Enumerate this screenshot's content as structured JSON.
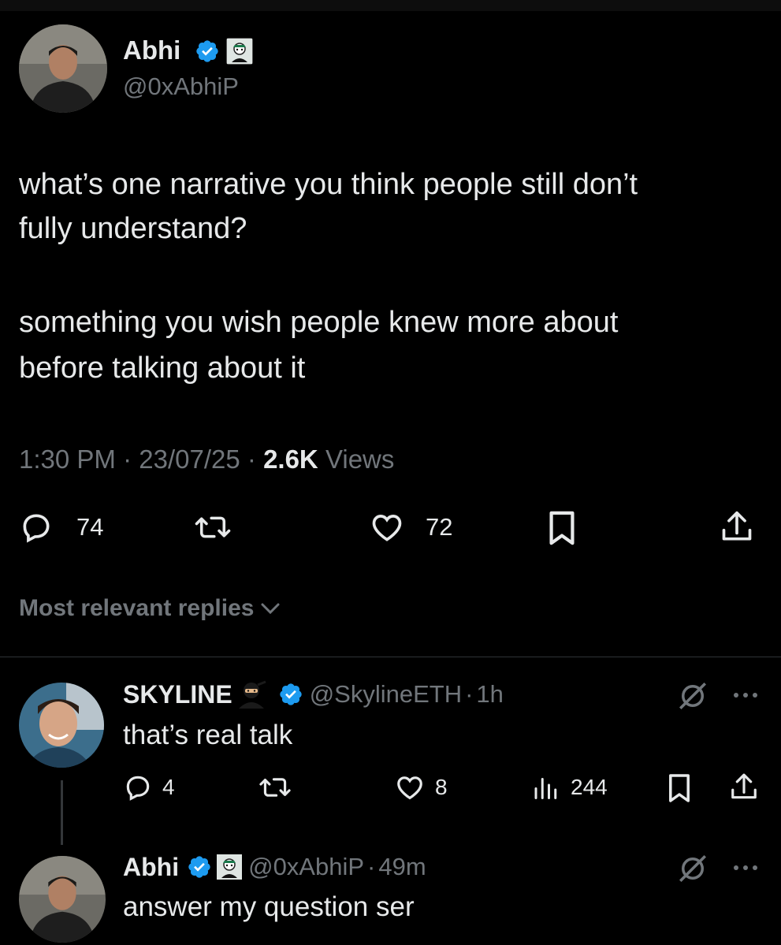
{
  "tweet": {
    "author_name": "Abhi",
    "author_handle": "@0xAbhiP",
    "text_line1": "what’s one narrative you think people still don’t",
    "text_line2": "fully understand?",
    "text_line3": "something you wish people knew more about",
    "text_line4": "before talking about it",
    "time": "1:30 PM",
    "date": "23/07/25",
    "views_count": "2.6K",
    "views_label": "Views",
    "replies": "74",
    "likes": "72"
  },
  "sort": {
    "label": "Most relevant replies"
  },
  "replies": [
    {
      "author_name": "SKYLINE",
      "author_handle": "@SkylineETH",
      "time": "1h",
      "text": "that’s real talk",
      "replies": "4",
      "likes": "8",
      "views": "244"
    },
    {
      "author_name": "Abhi",
      "author_handle": "@0xAbhiP",
      "time": "49m",
      "text": "answer my question ser"
    }
  ],
  "colors": {
    "background": "#000000",
    "text": "#e7e9ea",
    "muted": "#71767b",
    "verified": "#1d9bf0",
    "divider": "#2f3336"
  },
  "separator": "·"
}
